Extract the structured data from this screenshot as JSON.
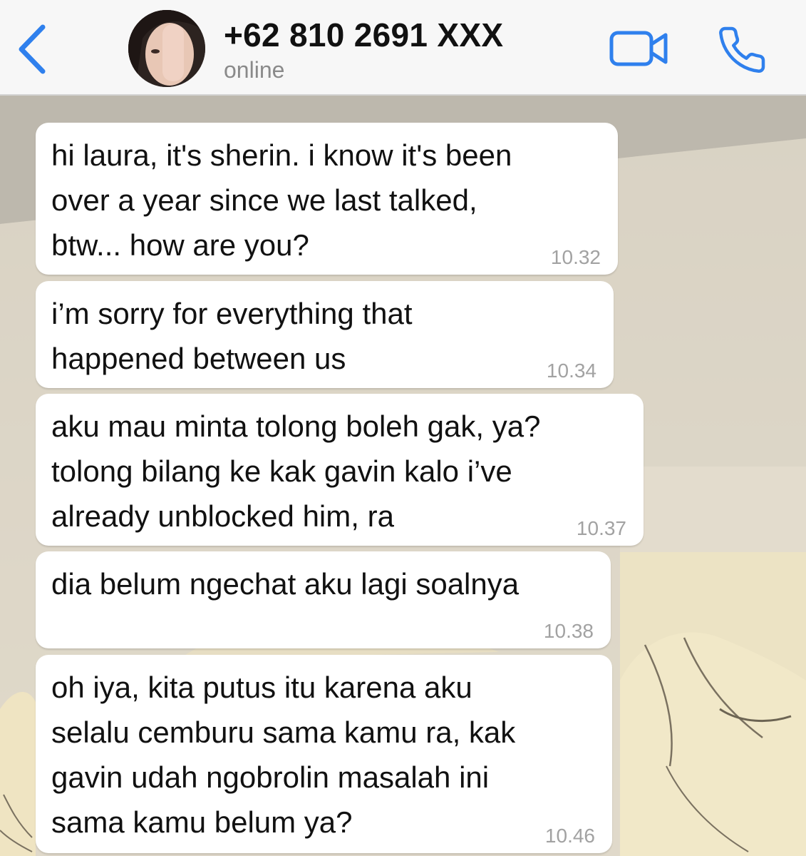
{
  "header": {
    "contact_name": "+62 810 2691 XXX",
    "status": "online"
  },
  "colors": {
    "accent": "#2f80ed",
    "bubble": "#ffffff",
    "timestamp": "#a2a2a2"
  },
  "icons": {
    "back": "chevron-left-icon",
    "video": "video-camera-icon",
    "call": "phone-icon"
  },
  "messages": [
    {
      "text": "hi laura, it's sherin. i know it's been\nover a year since we last talked,\nbtw... how are you?",
      "time": "10.32"
    },
    {
      "text": "i’m sorry for everything that\nhappened between us",
      "time": "10.34"
    },
    {
      "text": "aku mau minta tolong boleh gak, ya?\ntolong bilang ke kak gavin kalo i’ve\nalready unblocked him, ra",
      "time": "10.37"
    },
    {
      "text": "dia belum ngechat aku lagi soalnya",
      "time": "10.38"
    },
    {
      "text": "oh iya, kita putus itu karena aku\nselalu cemburu sama kamu ra, kak\ngavin udah ngobrolin masalah ini\nsama kamu belum ya?",
      "time": "10.46"
    }
  ]
}
